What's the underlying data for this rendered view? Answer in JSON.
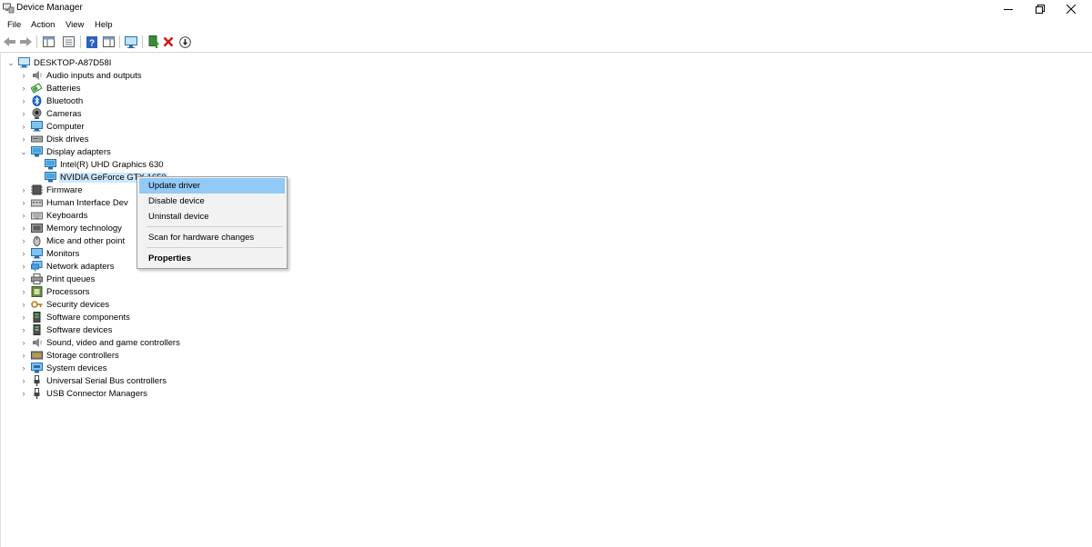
{
  "window": {
    "title": "Device Manager"
  },
  "menu": [
    "File",
    "Action",
    "View",
    "Help"
  ],
  "tree": {
    "root": "DESKTOP-A87D58I",
    "categories": [
      "Audio inputs and outputs",
      "Batteries",
      "Bluetooth",
      "Cameras",
      "Computer",
      "Disk drives",
      "Display adapters",
      "Firmware",
      "Human Interface Dev",
      "Keyboards",
      "Memory technology",
      "Mice and other point",
      "Monitors",
      "Network adapters",
      "Print queues",
      "Processors",
      "Security devices",
      "Software components",
      "Software devices",
      "Sound, video and game controllers",
      "Storage controllers",
      "System devices",
      "Universal Serial Bus controllers",
      "USB Connector Managers"
    ],
    "display_children": [
      "Intel(R) UHD Graphics 630",
      "NVIDIA GeForce GTX 1650"
    ]
  },
  "context_menu": {
    "items": [
      "Update driver",
      "Disable device",
      "Uninstall device",
      "Scan for hardware changes",
      "Properties"
    ],
    "highlighted": "Update driver"
  },
  "colors": {
    "selection": "#cce8ff",
    "menu_highlight": "#91c9f7",
    "menu_bg": "#f2f2f2"
  }
}
